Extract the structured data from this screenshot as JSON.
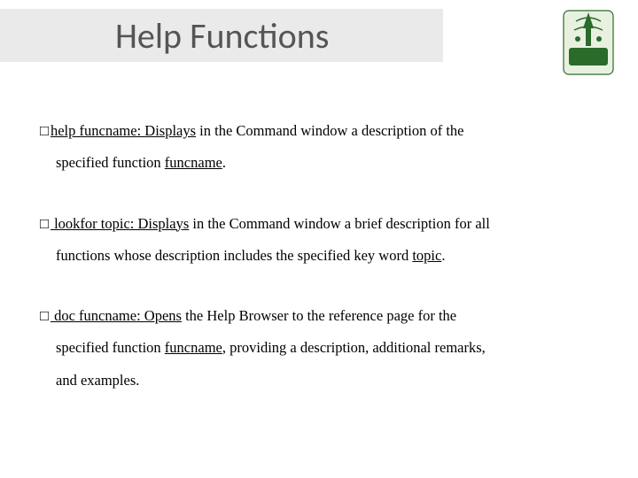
{
  "title": "Help Functions",
  "bullets": {
    "b1": {
      "square": "□",
      "cmd": "help funcname",
      "text1": ": Displays",
      "text2": " in the Command window a description of the",
      "cont1": "specified function ",
      "cont_cmd": "funcname",
      "cont2": "."
    },
    "b2": {
      "square": "□",
      "cmd": " lookfor topic",
      "text1": ": Displays",
      "text2": " in the Command window a brief description for all",
      "cont1": "functions whose description includes the specified key word ",
      "cont_cmd": "topic",
      "cont2": "."
    },
    "b3": {
      "square": "□",
      "cmd": " doc funcname",
      "text1": ": Opens",
      "text2": " the Help Browser to the reference page for the",
      "cont1": "specified function ",
      "cont_cmd": "funcname",
      "cont2": ", providing a description, additional remarks,",
      "cont3": "and examples."
    }
  }
}
